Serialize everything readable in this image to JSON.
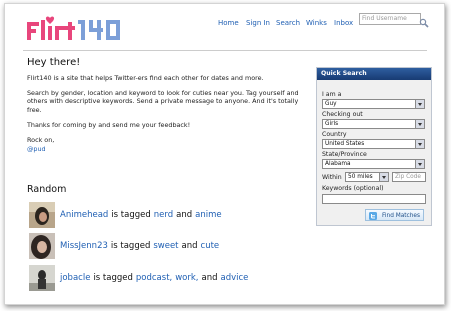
{
  "logo": {
    "text": "Flirt140"
  },
  "nav": {
    "home": "Home",
    "sign_in": "Sign In",
    "search": "Search",
    "winks": "Winks",
    "inbox": "Inbox",
    "find_placeholder": "Find Username"
  },
  "main": {
    "heading": "Hey there!",
    "p1": "Flirt140 is a site that helps Twitter-ers find each other for dates and more.",
    "p2": "Search by gender, location and keyword to look for cuties near you. Tag yourself and others with descriptive keywords. Send a private message to anyone. And it's totally free.",
    "p3": "Thanks for coming by and send me your feedback!",
    "sign_off": "Rock on,",
    "signature_link": "@pud"
  },
  "random": {
    "title": "Random",
    "tagged_word": "is tagged",
    "and_word": "and",
    "items": [
      {
        "user": "Animehead",
        "tags": [
          "nerd",
          "anime"
        ]
      },
      {
        "user": "MissJenn23",
        "tags": [
          "sweet",
          "cute"
        ]
      },
      {
        "user": "jobacle",
        "tags": [
          "podcast,",
          "work,"
        ],
        "and_prefix": ", and",
        "last_tag": "advice"
      }
    ]
  },
  "quick_search": {
    "title": "Quick Search",
    "i_am_label": "I am a",
    "i_am_value": "Guy",
    "checking_label": "Checking out",
    "checking_value": "Girls",
    "country_label": "Country",
    "country_value": "United States",
    "state_label": "State/Province",
    "state_value": "Alabama",
    "within_label": "Within",
    "within_value": "50 miles",
    "zip_placeholder": "Zip Code",
    "keywords_label": "Keywords (optional)",
    "keywords_value": "",
    "button_label": "Find Matches"
  },
  "colors": {
    "link": "#1f5fb3",
    "logo_pink": "#e8467c",
    "logo_blue": "#7c9fd8",
    "panel_header": "#244c8c"
  }
}
